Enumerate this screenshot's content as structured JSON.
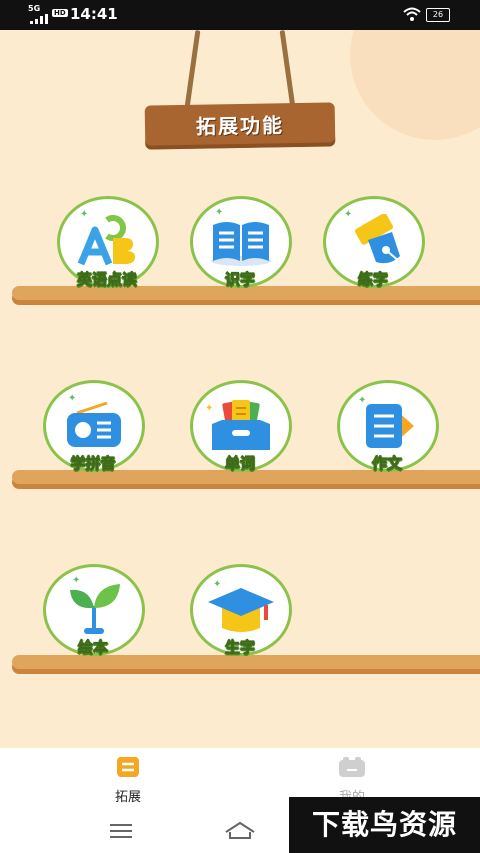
{
  "status_bar": {
    "network": "5G",
    "hd_badge": "HD",
    "time": "14:41",
    "battery": "26"
  },
  "header": {
    "title": "拓展功能"
  },
  "functions": [
    {
      "label": "英语点读",
      "icon": "abc-letters-icon"
    },
    {
      "label": "识字",
      "icon": "open-book-icon"
    },
    {
      "label": "练字",
      "icon": "pen-nib-icon"
    },
    {
      "label": "学拼音",
      "icon": "radio-icon"
    },
    {
      "label": "单词",
      "icon": "card-box-icon"
    },
    {
      "label": "作文",
      "icon": "document-icon"
    },
    {
      "label": "绘本",
      "icon": "plant-icon"
    },
    {
      "label": "生字",
      "icon": "graduation-cap-icon"
    }
  ],
  "tabbar": {
    "expand_label": "拓展",
    "mine_label": "我的"
  },
  "watermark": "下载鸟资源",
  "colors": {
    "background": "#fdebd0",
    "shelf": "#e0a55d",
    "circle_border": "#8bc34a",
    "sign": "#a9652f"
  }
}
